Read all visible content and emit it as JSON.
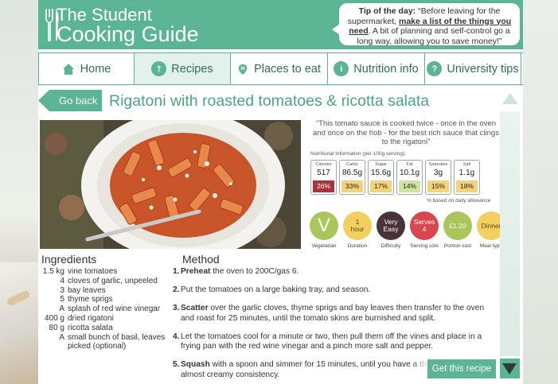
{
  "header": {
    "logo_line1": "The Student",
    "logo_line2": "Cooking Guide",
    "tip_label": "Tip of the day:",
    "tip_pre": " “Before leaving for the supermarket, ",
    "tip_link": "make a list of the things you need",
    "tip_post": ". A bit of planning and self-control go a long way, allowing you to save money!”"
  },
  "nav": [
    {
      "label": "Home",
      "icon": "home-icon"
    },
    {
      "label": "Recipes",
      "icon": "cutlery-icon",
      "active": true
    },
    {
      "label": "Places to eat",
      "icon": "map-pin-icon"
    },
    {
      "label": "Nutrition info",
      "icon": "info-icon"
    },
    {
      "label": "University tips",
      "icon": "question-icon"
    }
  ],
  "back_label": "Go back",
  "recipe_title": "Rigatoni with roasted tomatoes & ricotta salata",
  "quote": "“This tomato sauce is cooked twice - once in the oven and once on the hob - for the best rich sauce that clings to the rigatoni”",
  "nutrition": {
    "label": "Nutritional Information (per 100g serving):",
    "items": [
      {
        "name": "Calories",
        "value": "517",
        "pct": "26%",
        "color": "#a8333d",
        "text": "#ffffff"
      },
      {
        "name": "Carbs",
        "value": "86.5g",
        "pct": "33%",
        "color": "#f3d27a",
        "text": "#222222"
      },
      {
        "name": "Sugar",
        "value": "15.6g",
        "pct": "17%",
        "color": "#f3d27a",
        "text": "#222222"
      },
      {
        "name": "Fat",
        "value": "10.1g",
        "pct": "14%",
        "color": "#cfe4a0",
        "text": "#222222"
      },
      {
        "name": "Saturates",
        "value": "3g",
        "pct": "15%",
        "color": "#f3d27a",
        "text": "#222222"
      },
      {
        "name": "Salt",
        "value": "1.1g",
        "pct": "18%",
        "color": "#f3d27a",
        "text": "#222222"
      }
    ],
    "note": "% based on daily allowance"
  },
  "badges": [
    {
      "line1": "V",
      "line2": "",
      "caption": "Vegetarian",
      "color": "#a9c65a",
      "text": "#ffffff",
      "big": true
    },
    {
      "line1": "1",
      "line2": "hour",
      "caption": "Duration",
      "color": "#f2cf5e",
      "text": "#5a4a14"
    },
    {
      "line1": "Very",
      "line2": "Easy",
      "caption": "Difficulty",
      "color": "#4a3338",
      "text": "#ffffff"
    },
    {
      "line1": "Serves",
      "line2": "4",
      "caption": "Serving size",
      "color": "#d8474e",
      "text": "#ffffff"
    },
    {
      "line1": "£1.20",
      "line2": "",
      "caption": "Portion cost",
      "color": "#a9c65a",
      "text": "#ffffff"
    },
    {
      "line1": "Dinner",
      "line2": "",
      "caption": "Meal type",
      "color": "#f2cf5e",
      "text": "#5a4a14"
    }
  ],
  "ingredients_title": "Ingredients",
  "ingredients": [
    {
      "qty": "1.5 kg",
      "name": "vine tomatoes"
    },
    {
      "qty": "4",
      "name": "cloves of garlic, unpeeled"
    },
    {
      "qty": "3",
      "name": "bay leaves"
    },
    {
      "qty": "5",
      "name": "thyme sprigs"
    },
    {
      "qty": "A",
      "name": "splash of red wine vinegar"
    },
    {
      "qty": "400 g",
      "name": "dried rigatoni"
    },
    {
      "qty": "80 g",
      "name": "ricotta salata"
    },
    {
      "qty": "A",
      "name": "small bunch of basil, leaves picked (optional)"
    }
  ],
  "method_title": "Method",
  "method": [
    {
      "num": "1.",
      "bold": "Preheat",
      "text": " the oven to 200C/gas 6."
    },
    {
      "num": "2.",
      "bold": "",
      "text": "Put the tomatoes on a large baking tray, and season."
    },
    {
      "num": "3.",
      "bold": "Scatter",
      "text": " over the garlic cloves, thyme sprigs and bay leaves then transfer to the oven and roast for 25 minutes, until the tomato skins are burnished and split."
    },
    {
      "num": "4.",
      "bold": "",
      "text": "Let the tomatoes cool for a minute or two, then pull them off the vines and place in a frying pan with the red wine vinegar and a pinch more salt and pepper."
    },
    {
      "num": "5.",
      "bold": "Squash",
      "text": " with a spoon and simmer for 15 minutes, until you have a thick sauce with an almost creamy consistency."
    }
  ],
  "get_recipe_label": "Get this recipe"
}
